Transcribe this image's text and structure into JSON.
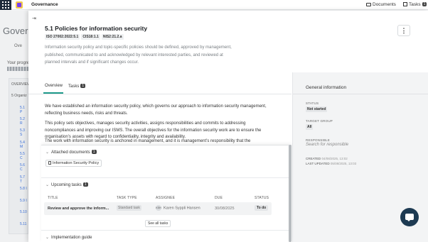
{
  "topbar": {
    "app_title": "Governance",
    "documents_label": "Documents",
    "tasks_label": "Tasks",
    "tasks_count": "1"
  },
  "background": {
    "title": "Govern",
    "tab": "Ove",
    "progress_label": "Your progre",
    "column_header": "OVERVIEW",
    "row_header": "5 Organiz",
    "rows": [
      "5.1 P",
      "5.2 R",
      "5.3 S",
      "5.4 M",
      "5.5 C",
      "5.6 C",
      "5.7 T",
      "5.8 I",
      "5.9 I",
      "5.10",
      "5.11"
    ]
  },
  "modal": {
    "collapse_glyph": "⇥",
    "title": "5.1 Policies for information security",
    "chips": [
      "ISO 27002:2022:5.1",
      "CIS18:1.1",
      "NIS2:21.2.a"
    ],
    "description": "Information security policy and topic-specific policies should be defined, approved by management, published, communicated to and acknowledged by relevant interested parties, and reviewed at planned intervals and if significant changes occur.",
    "tabs": {
      "overview": "Overview",
      "tasks": "Tasks",
      "tasks_count": "1"
    },
    "body": [
      "We have established an information security policy, which governs our approach to information security management, reflecting business needs, risks and threats.",
      "This policy sets objectives, manages security activities, assigns responsibilities and commits to addressing noncompliances and improving our ISMS. The overall objectives for the information security work are to ensure the organisation’s assets with regard to confidentiality, integrity and availability.",
      "The work with information security is anchored in management, and it is management’s responsibility that the"
    ],
    "general_info": {
      "title": "General information",
      "status_label": "STATUS",
      "status_value": "Not started",
      "target_group_label": "TARGET GROUP",
      "target_group_value": "All",
      "responsible_label": "RESPONSIBLE",
      "responsible_placeholder": "Search for responsible",
      "created_label": "CREATED",
      "created_value": "04/08/2025, 13:02",
      "updated_label": "LAST UPDATED",
      "updated_value": "05/08/2025, 13:03"
    }
  },
  "sheet": {
    "attached_label": "Attached documents",
    "attached_count": "1",
    "document": "Information Security Policy",
    "upcoming_label": "Upcoming tasks",
    "upcoming_count": "1",
    "columns": [
      "TITLE",
      "TASK TYPE",
      "ASSIGNEE",
      "DUE",
      "STATUS"
    ],
    "task": {
      "title": "Review and approve the inform...",
      "type": "Standard task",
      "assignee_initials": "KSH",
      "assignee": "Karen Syppli Hansen",
      "due": "30/08/2025",
      "status": "To do"
    },
    "see_all": "See all tasks",
    "implementation_label": "Implementation guide"
  }
}
